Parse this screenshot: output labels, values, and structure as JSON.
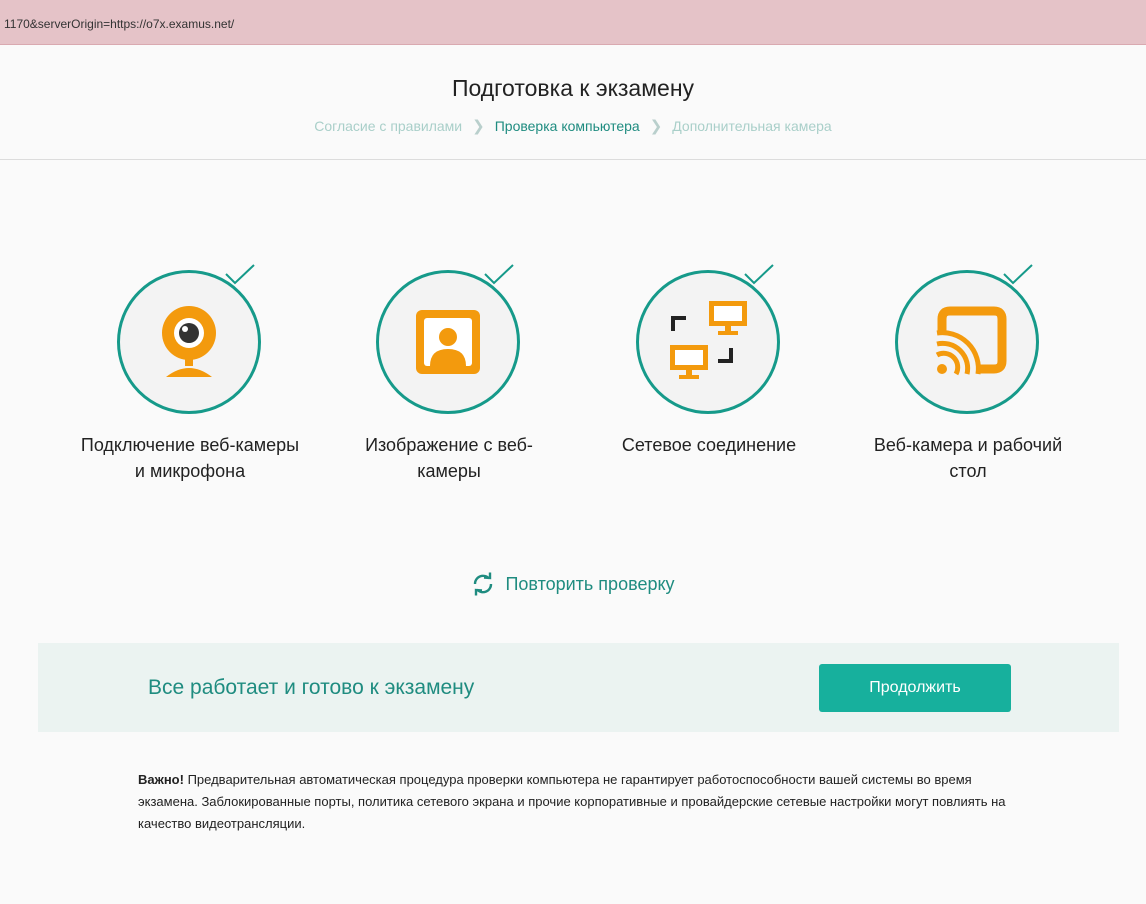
{
  "browser": {
    "url": "1170&serverOrigin=https://o7x.examus.net/"
  },
  "header": {
    "title": "Подготовка к экзамену",
    "breadcrumb": [
      "Согласие с правилами",
      "Проверка компьютера",
      "Дополнительная камера"
    ],
    "active_step_index": 1
  },
  "checks": [
    {
      "label": "Подключение веб-камеры и микрофона",
      "icon": "webcam-icon",
      "status": "ok"
    },
    {
      "label": "Изображение с веб-камеры",
      "icon": "user-portrait-icon",
      "status": "ok"
    },
    {
      "label": "Сетевое соединение",
      "icon": "network-computers-icon",
      "status": "ok"
    },
    {
      "label": "Веб-камера и рабочий стол",
      "icon": "screencast-icon",
      "status": "ok"
    }
  ],
  "retry": {
    "label": "Повторить проверку",
    "icon": "refresh-icon"
  },
  "ready_panel": {
    "message": "Все работает и готово к экзамену",
    "continue_label": "Продолжить"
  },
  "note": {
    "bold": "Важно!",
    "text": " Предварительная автоматическая процедура проверки компьютера не гарантирует работоспособности вашей системы во время экзамена. Заблокированные порты, политика сетевого экрана и прочие корпоративные и провайдерские сетевые настройки могут повлиять на качество видеотрансляции."
  },
  "colors": {
    "accent": "#1f8c80",
    "button": "#17b09d",
    "icon": "#f39a0d",
    "panel": "#ebf3f1"
  }
}
